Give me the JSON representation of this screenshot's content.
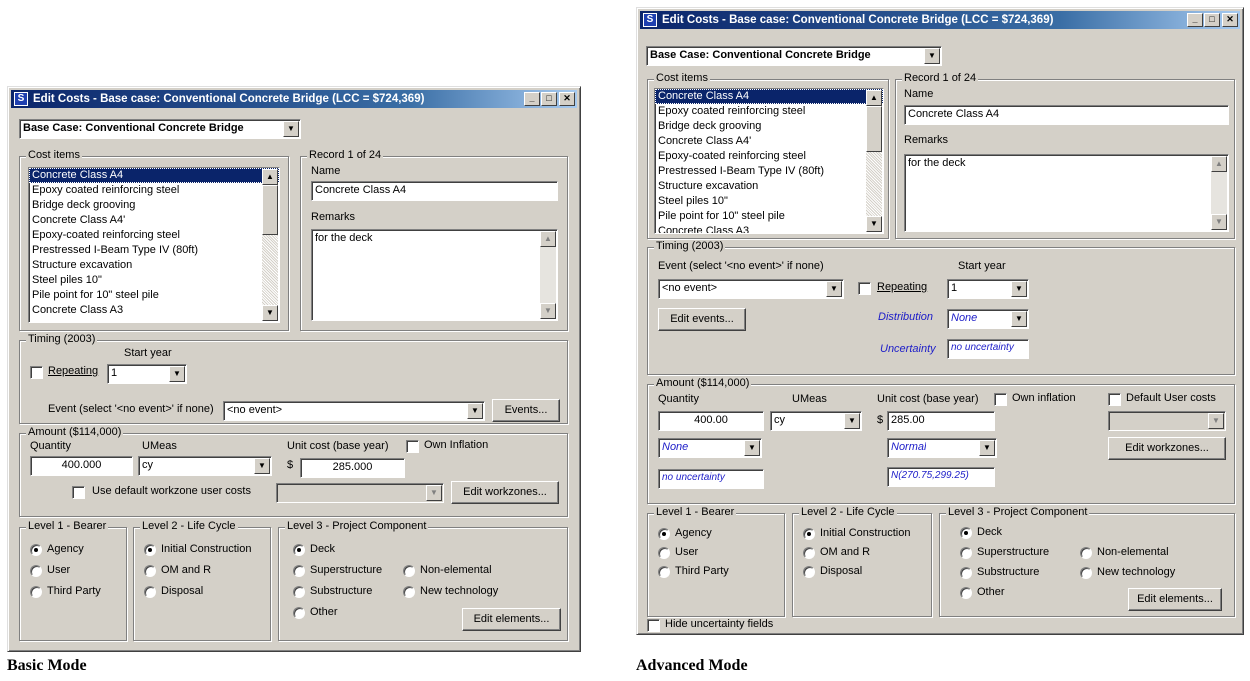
{
  "window_title": "Edit Costs - Base case: Conventional Concrete Bridge (LCC = $724,369)",
  "case_select": "Base Case: Conventional Concrete Bridge",
  "cost_items_label": "Cost items",
  "cost_items": [
    "Concrete Class A4",
    "Epoxy coated reinforcing steel",
    "Bridge deck grooving",
    "Concrete Class A4'",
    "Epoxy-coated reinforcing steel",
    "Prestressed I-Beam Type IV (80ft)",
    "Structure excavation",
    "Steel piles 10\"",
    "Pile point for 10\" steel pile",
    "Concrete Class A3"
  ],
  "record_label": "Record 1 of  24",
  "name_label": "Name",
  "name_value": "Concrete Class A4",
  "remarks_label": "Remarks",
  "remarks_value": "for the deck",
  "timing_label": "Timing (2003)",
  "repeating_label": "Repeating",
  "start_year_label": "Start year",
  "start_year_value": "1",
  "event_label": "Event (select '<no event>' if none)",
  "event_value": "<no event>",
  "events_button": "Events...",
  "edit_events_button": "Edit events...",
  "distribution_label": "Distribution",
  "distribution_value": "None",
  "uncertainty_label": "Uncertainty",
  "uncertainty_value": "no uncertainty",
  "amount_label": "Amount ($114,000)",
  "quantity_label": "Quantity",
  "basic_quantity_value": "400.000",
  "adv_quantity_value": "400.00",
  "umeas_label": "UMeas",
  "umeas_value": "cy",
  "unit_cost_label": "Unit cost (base year)",
  "dollar_sign": "$",
  "basic_unit_cost_value": "285.000",
  "adv_unit_cost_value": "285.00",
  "basic_own_inflation_label": "Own Inflation",
  "adv_own_inflation_label": "Own inflation",
  "default_user_costs_label": "Default User costs",
  "use_default_workzone_label": "Use default workzone user costs",
  "edit_workzones_button": "Edit workzones...",
  "qty_distribution_value": "None",
  "qty_uncertainty_value": "no uncertainty",
  "cost_distribution_value": "Normal",
  "cost_uncertainty_value": "N(270.75,299.25)",
  "level1_label": "Level 1 - Bearer",
  "level1_options": [
    "Agency",
    "User",
    "Third Party"
  ],
  "level2_label": "Level 2 - Life Cycle",
  "level2_options": [
    "Initial Construction",
    "OM and R",
    "Disposal"
  ],
  "level3_label": "Level 3 - Project Component",
  "level3_options": [
    "Deck",
    "Superstructure",
    "Substructure",
    "Other",
    "Non-elemental",
    "New technology"
  ],
  "edit_elements_button": "Edit elements...",
  "hide_uncertainty_label": "Hide uncertainty fields",
  "basic_caption": "Basic Mode",
  "advanced_caption": "Advanced Mode"
}
